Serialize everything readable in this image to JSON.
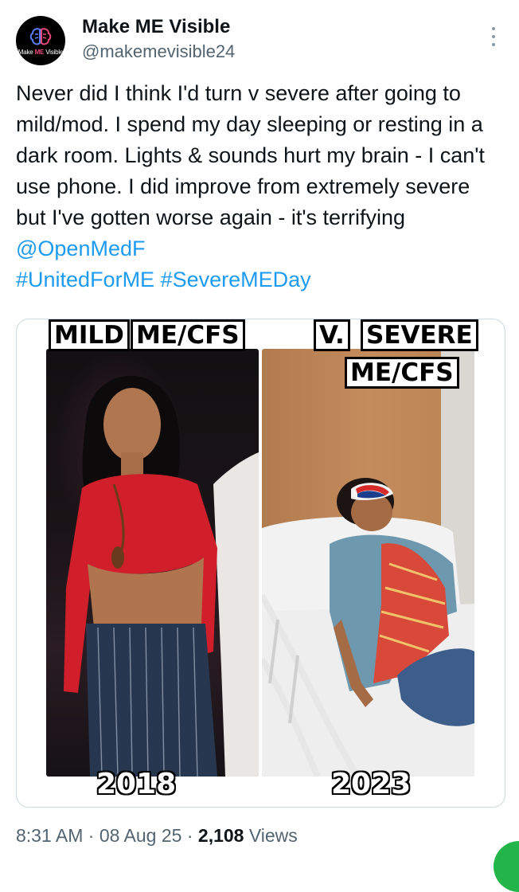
{
  "account": {
    "display_name": "Make ME Visible",
    "handle": "@makemevisible24",
    "avatar_text_pre": "Make ",
    "avatar_text_accent": "ME",
    "avatar_text_post": " Visible",
    "avatar_icon": "brain-icon"
  },
  "tweet": {
    "text": "Never did I think I'd turn v severe after going to mild/mod. I spend my day sleeping or resting in a dark room. Lights & sounds hurt my brain - I can't use phone. I did improve from extremely severe but I've gotten worse again - it's terrifying ",
    "mention": "@OpenMedF",
    "hashtags": [
      "#UnitedForME",
      "#SevereMEDay"
    ]
  },
  "media": {
    "left": {
      "label_parts": [
        "MILD",
        "ME/CFS"
      ],
      "year": "2018"
    },
    "right": {
      "label_parts": [
        "V.",
        "SEVERE",
        "ME/CFS"
      ],
      "year": "2023"
    }
  },
  "meta": {
    "time": "8:31 AM",
    "date": "08 Aug 25",
    "separator": "·",
    "views_count": "2,108",
    "views_label": "Views"
  },
  "colors": {
    "link": "#1d9bf0",
    "secondary_text": "#536471",
    "brand_pink": "#e8497a",
    "fab_green": "#22b64a"
  },
  "icons": [
    "more-vertical-icon",
    "brain-icon"
  ]
}
